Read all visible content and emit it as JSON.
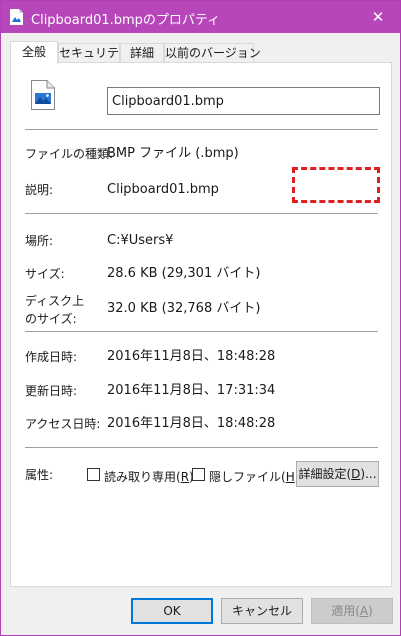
{
  "window": {
    "title": "Clipboard01.bmpのプロパティ",
    "close_glyph": "✕"
  },
  "tabs": [
    {
      "label": "全般",
      "active": true
    },
    {
      "label": "セキュリティ",
      "active": false
    },
    {
      "label": "詳細",
      "active": false
    },
    {
      "label": "以前のバージョン",
      "active": false
    }
  ],
  "general": {
    "filename": "Clipboard01.bmp",
    "file_type_label": "ファイルの種類:",
    "file_type_value": "BMP ファイル (.bmp)",
    "description_label": "説明:",
    "description_value": "Clipboard01.bmp",
    "location_label": "場所:",
    "location_value": "C:¥Users¥",
    "size_label": "サイズ:",
    "size_value": "28.6 KB (29,301 バイト)",
    "disk_size_label_1": "ディスク上",
    "disk_size_label_2": "のサイズ:",
    "disk_size_value": "32.0 KB (32,768 バイト)",
    "created_label": "作成日時:",
    "created_value": "2016年11月8日、18:48:28",
    "modified_label": "更新日時:",
    "modified_value": "2016年11月8日、17:31:34",
    "accessed_label": "アクセス日時:",
    "accessed_value": "2016年11月8日、18:48:28",
    "attributes_label": "属性:",
    "readonly_label": "読み取り専用(",
    "readonly_key": "R",
    "hidden_label": "隠しファイル(",
    "hidden_key": "H",
    "advanced_label": "詳細設定(",
    "advanced_key": "D",
    "advanced_suffix": ")..."
  },
  "buttons": {
    "ok": "OK",
    "cancel": "キャンセル",
    "apply_label": "適用(",
    "apply_key": "A"
  },
  "colors": {
    "titlebar": "#b646b9",
    "annotation": "#e02020",
    "default_button": "#0078d7"
  }
}
